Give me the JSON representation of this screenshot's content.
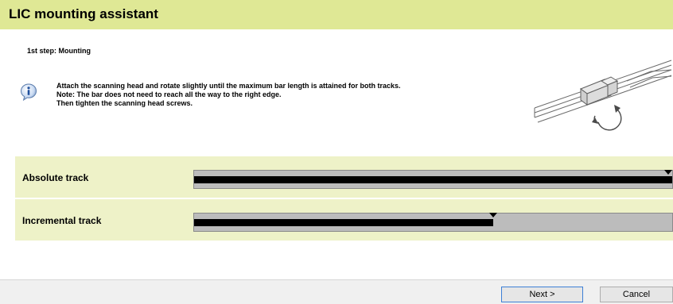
{
  "window": {
    "title": "LIC mounting assistant",
    "header_color": "#dfe895"
  },
  "step": {
    "label": "1st step: Mounting"
  },
  "instructions": {
    "icon": "info-icon",
    "lines": [
      "Attach the scanning head and rotate slightly until the maximum bar length is attained for both tracks.",
      "Note: The bar does not need to reach all the way to the right edge.",
      "Then tighten the scanning head screws."
    ]
  },
  "illustration": {
    "icon": "scanning-head-rotation-illustration"
  },
  "tracks": [
    {
      "label": "Absolute track",
      "level": 1.0,
      "marker": 1.0
    },
    {
      "label": "Incremental track",
      "level": 0.626,
      "marker": 0.626
    }
  ],
  "colors": {
    "track_panel": "#eef2c8",
    "bar_background": "#bcbcbc",
    "bar_fill": "#000000",
    "next_button_border": "#3c7fd6"
  },
  "footer": {
    "next_label": "Next >",
    "cancel_label": "Cancel"
  }
}
